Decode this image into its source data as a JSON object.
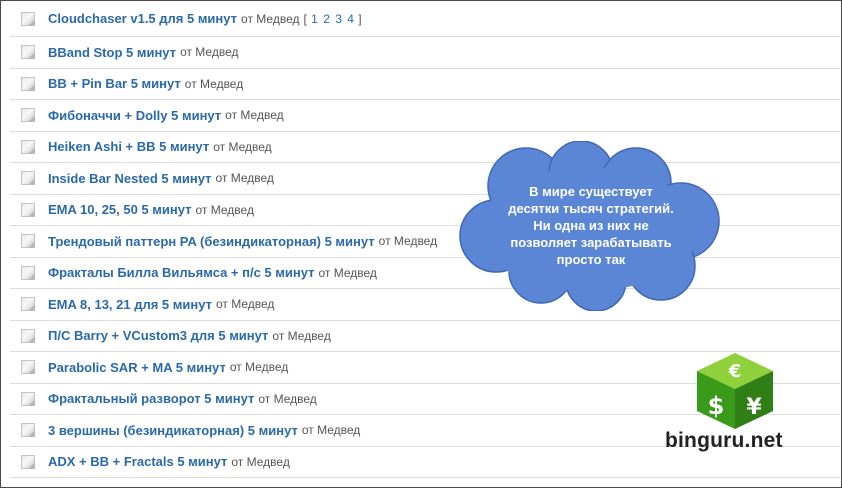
{
  "topics": [
    {
      "title": "Cloudchaser v1.5 для 5 минут",
      "author": "от Медвед",
      "pages": [
        "1",
        "2",
        "3",
        "4"
      ]
    },
    {
      "title": "BBand Stop 5 минут",
      "author": "от Медвед"
    },
    {
      "title": "BB + Pin Bar 5 минут",
      "author": "от Медвед"
    },
    {
      "title": "Фибоначчи + Dolly 5 минут",
      "author": "от Медвед"
    },
    {
      "title": "Heiken Ashi + BB 5 минут",
      "author": "от Медвед"
    },
    {
      "title": "Inside Bar Nested 5 минут",
      "author": "от Медвед"
    },
    {
      "title": "EMA 10, 25, 50 5 минут",
      "author": "от Медвед"
    },
    {
      "title": "Трендовый паттерн PA (безиндикаторная) 5 минут",
      "author": "от Медвед"
    },
    {
      "title": "Фракталы Билла Вильямса + п/с 5 минут",
      "author": "от Медвед"
    },
    {
      "title": "EMA 8, 13, 21 для 5 минут",
      "author": "от Медвед"
    },
    {
      "title": "П/С Barry + VCustom3 для 5 минут",
      "author": "от Медвед"
    },
    {
      "title": "Parabolic SAR + MA 5 минут",
      "author": "от Медвед"
    },
    {
      "title": "Фрактальный разворот 5 минут",
      "author": "от Медвед"
    },
    {
      "title": "3 вершины (безиндикаторная) 5 минут",
      "author": "от Медвед"
    },
    {
      "title": "ADX + BB + Fractals 5 минут",
      "author": "от Медвед"
    }
  ],
  "cloud": {
    "lines": [
      "В мире существует",
      "десятки тысяч стратегий.",
      "Ни одна из них не",
      "позволяет зарабатывать",
      "просто так"
    ],
    "color": "#5b86d6"
  },
  "logo": {
    "brand": "binguru.net",
    "icon": "currency-cube-icon",
    "symbols": {
      "euro": "€",
      "dollar": "$",
      "yen": "¥"
    },
    "colors": {
      "top": "#8ed13a",
      "left": "#3a9a1a",
      "right": "#2f7f16"
    }
  }
}
